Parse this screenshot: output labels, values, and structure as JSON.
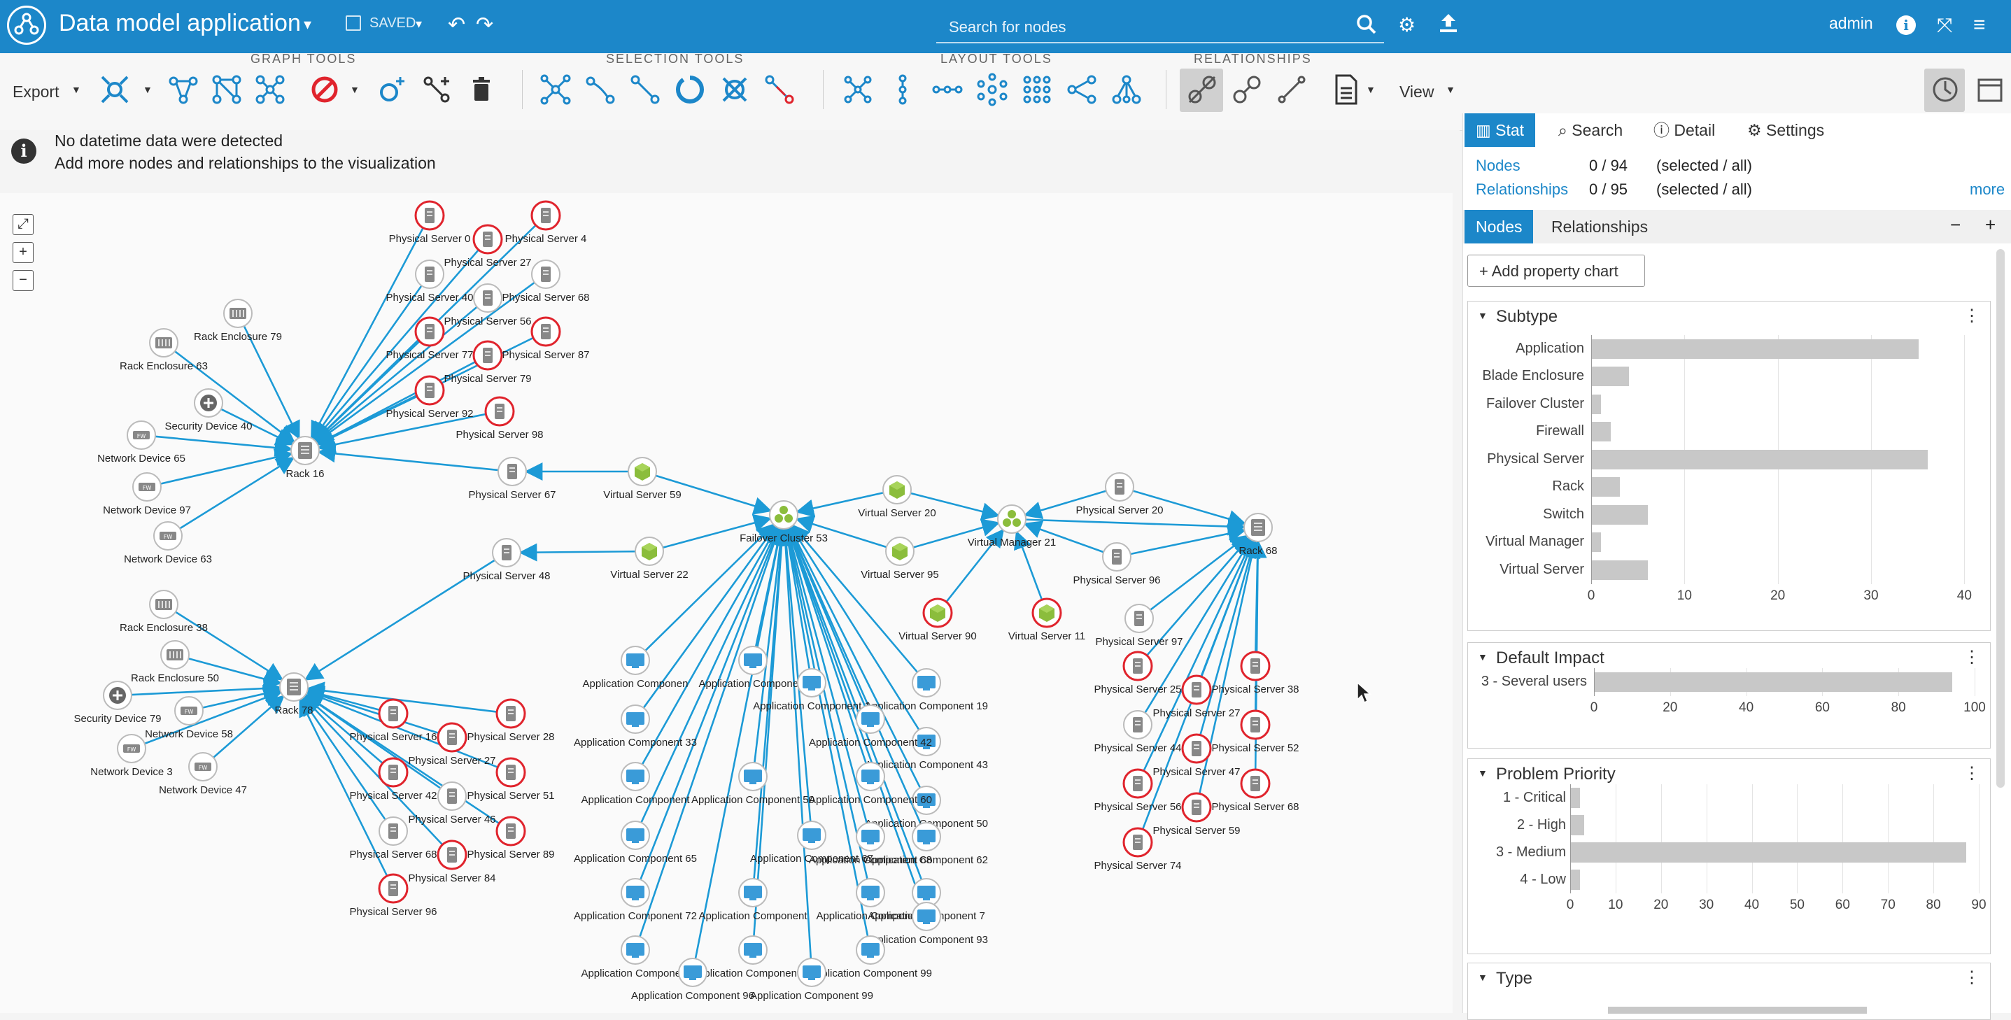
{
  "header": {
    "title": "Data model application",
    "saved": "SAVED",
    "search_placeholder": "Search for nodes",
    "user": "admin"
  },
  "toolbar": {
    "export_label": "Export",
    "view_label": "View",
    "groups": [
      "GRAPH TOOLS",
      "SELECTION TOOLS",
      "LAYOUT TOOLS",
      "RELATIONSHIPS"
    ]
  },
  "info": {
    "line1": "No datetime data were detected",
    "line2": "Add more nodes and relationships to the visualization"
  },
  "panel": {
    "tabs": [
      "Stat",
      "Search",
      "Detail",
      "Settings"
    ],
    "nodes_label": "Nodes",
    "nodes_count": "0 / 94",
    "nodes_hint": "(selected / all)",
    "rels_label": "Relationships",
    "rels_count": "0 / 95",
    "rels_hint": "(selected / all)",
    "more": "more",
    "subtabs": [
      "Nodes",
      "Relationships"
    ],
    "add_chart": "Add property chart"
  },
  "charts": [
    {
      "title": "Subtype",
      "categories": [
        "Application",
        "Blade Enclosure",
        "Failover Cluster",
        "Firewall",
        "Physical Server",
        "Rack",
        "Switch",
        "Virtual Manager",
        "Virtual Server"
      ],
      "values": [
        35,
        4,
        1,
        2,
        36,
        3,
        6,
        1,
        6
      ],
      "max": 42,
      "ticks": [
        0,
        10,
        20,
        30,
        40
      ]
    },
    {
      "title": "Default Impact",
      "categories": [
        "3 - Several users"
      ],
      "values": [
        94
      ],
      "max": 100,
      "ticks": [
        0,
        20,
        40,
        60,
        80,
        100
      ]
    },
    {
      "title": "Problem Priority",
      "categories": [
        "1 - Critical",
        "2 - High",
        "3 - Medium",
        "4 - Low"
      ],
      "values": [
        2,
        3,
        87,
        2
      ],
      "max": 90,
      "ticks": [
        0,
        10,
        20,
        30,
        40,
        50,
        60,
        70,
        80,
        90
      ]
    },
    {
      "title": "Type"
    }
  ],
  "graph": {
    "nodes": [
      {
        "id": "ps0",
        "label": "Physical Server 0",
        "type": "server",
        "alert": true
      },
      {
        "id": "ps4",
        "label": "Physical Server 4",
        "type": "server",
        "alert": true
      },
      {
        "id": "ps27a",
        "label": "Physical Server 27",
        "type": "server",
        "alert": true
      },
      {
        "id": "ps40",
        "label": "Physical Server 40",
        "type": "server",
        "alert": false
      },
      {
        "id": "ps68a",
        "label": "Physical Server 68",
        "type": "server",
        "alert": false
      },
      {
        "id": "ps56a",
        "label": "Physical Server 56",
        "type": "server",
        "alert": false
      },
      {
        "id": "ps77",
        "label": "Physical Server 77",
        "type": "server",
        "alert": true
      },
      {
        "id": "ps87",
        "label": "Physical Server 87",
        "type": "server",
        "alert": true
      },
      {
        "id": "ps79",
        "label": "Physical Server 79",
        "type": "server",
        "alert": true
      },
      {
        "id": "ps92",
        "label": "Physical Server 92",
        "type": "server",
        "alert": true
      },
      {
        "id": "ps98",
        "label": "Physical Server 98",
        "type": "server",
        "alert": true
      },
      {
        "id": "re79",
        "label": "Rack Enclosure 79",
        "type": "enclosure",
        "alert": false
      },
      {
        "id": "re63",
        "label": "Rack Enclosure 63",
        "type": "enclosure",
        "alert": false
      },
      {
        "id": "sd40",
        "label": "Security Device 40",
        "type": "security",
        "alert": false
      },
      {
        "id": "nd65",
        "label": "Network Device 65",
        "type": "network",
        "alert": false
      },
      {
        "id": "nd97",
        "label": "Network Device 97",
        "type": "network",
        "alert": false
      },
      {
        "id": "nd63",
        "label": "Network Device 63",
        "type": "network",
        "alert": false
      },
      {
        "id": "rack16",
        "label": "Rack 16",
        "type": "rack",
        "alert": false
      },
      {
        "id": "ps67",
        "label": "Physical Server 67",
        "type": "server",
        "alert": false
      },
      {
        "id": "vs59",
        "label": "Virtual Server 59",
        "type": "virtual",
        "alert": false
      },
      {
        "id": "fc53",
        "label": "Failover Cluster 53",
        "type": "cluster",
        "alert": false
      },
      {
        "id": "vs20",
        "label": "Virtual Server 20",
        "type": "virtual",
        "alert": false
      },
      {
        "id": "vs95",
        "label": "Virtual Server 95",
        "type": "virtual",
        "alert": false
      },
      {
        "id": "vm21",
        "label": "Virtual Manager 21",
        "type": "cluster",
        "alert": false
      },
      {
        "id": "vs90",
        "label": "Virtual Server 90",
        "type": "virtual",
        "alert": true
      },
      {
        "id": "vs11",
        "label": "Virtual Server 11",
        "type": "virtual",
        "alert": true
      },
      {
        "id": "ps20",
        "label": "Physical Server 20",
        "type": "server",
        "alert": false
      },
      {
        "id": "ps96a",
        "label": "Physical Server 96",
        "type": "server",
        "alert": false
      },
      {
        "id": "rack68",
        "label": "Rack 68",
        "type": "rack",
        "alert": false
      },
      {
        "id": "vs22",
        "label": "Virtual Server 22",
        "type": "virtual",
        "alert": false
      },
      {
        "id": "ps48",
        "label": "Physical Server 48",
        "type": "server",
        "alert": false
      },
      {
        "id": "re38",
        "label": "Rack Enclosure 38",
        "type": "enclosure",
        "alert": false
      },
      {
        "id": "re50",
        "label": "Rack Enclosure 50",
        "type": "enclosure",
        "alert": false
      },
      {
        "id": "sd79",
        "label": "Security Device 79",
        "type": "security",
        "alert": false
      },
      {
        "id": "nd58",
        "label": "Network Device 58",
        "type": "network",
        "alert": false
      },
      {
        "id": "nd3",
        "label": "Network Device 3",
        "type": "network",
        "alert": false
      },
      {
        "id": "nd47",
        "label": "Network Device 47",
        "type": "network",
        "alert": false
      },
      {
        "id": "rack78",
        "label": "Rack 78",
        "type": "rack",
        "alert": false
      },
      {
        "id": "ps16",
        "label": "Physical Server 16",
        "type": "server",
        "alert": true
      },
      {
        "id": "ps28",
        "label": "Physical Server 28",
        "type": "server",
        "alert": true
      },
      {
        "id": "ps27b",
        "label": "Physical Server 27",
        "type": "server",
        "alert": true
      },
      {
        "id": "ps42",
        "label": "Physical Server 42",
        "type": "server",
        "alert": true
      },
      {
        "id": "ps51",
        "label": "Physical Server 51",
        "type": "server",
        "alert": true
      },
      {
        "id": "ps46",
        "label": "Physical Server 46",
        "type": "server",
        "alert": false
      },
      {
        "id": "ps68b",
        "label": "Physical Server 68",
        "type": "server",
        "alert": false
      },
      {
        "id": "ps89",
        "label": "Physical Server 89",
        "type": "server",
        "alert": true
      },
      {
        "id": "ps84",
        "label": "Physical Server 84",
        "type": "server",
        "alert": true
      },
      {
        "id": "ps96b",
        "label": "Physical Server 96",
        "type": "server",
        "alert": true
      },
      {
        "id": "ps97",
        "label": "Physical Server 97",
        "type": "server",
        "alert": false
      },
      {
        "id": "ps25",
        "label": "Physical Server 25",
        "type": "server",
        "alert": true
      },
      {
        "id": "ps38",
        "label": "Physical Server 38",
        "type": "server",
        "alert": true
      },
      {
        "id": "ps27c",
        "label": "Physical Server 27",
        "type": "server",
        "alert": true
      },
      {
        "id": "ps44",
        "label": "Physical Server 44",
        "type": "server",
        "alert": false
      },
      {
        "id": "ps52",
        "label": "Physical Server 52",
        "type": "server",
        "alert": true
      },
      {
        "id": "ps47",
        "label": "Physical Server 47",
        "type": "server",
        "alert": true
      },
      {
        "id": "ps56b",
        "label": "Physical Server 56",
        "type": "server",
        "alert": true
      },
      {
        "id": "ps68c",
        "label": "Physical Server 68",
        "type": "server",
        "alert": true
      },
      {
        "id": "ps59",
        "label": "Physical Server 59",
        "type": "server",
        "alert": true
      },
      {
        "id": "ps74",
        "label": "Physical Server 74",
        "type": "server",
        "alert": true
      },
      {
        "id": "ac_a",
        "label": "Application Componen",
        "type": "app",
        "alert": false
      },
      {
        "id": "ac_b",
        "label": "Application Component",
        "type": "app",
        "alert": false
      },
      {
        "id": "ac_c",
        "label": "Application Component 19",
        "type": "app",
        "alert": false
      },
      {
        "id": "ac_d",
        "label": "Application Component 1",
        "type": "app",
        "alert": false
      },
      {
        "id": "ac_e",
        "label": "Application Component 33",
        "type": "app",
        "alert": false
      },
      {
        "id": "ac_f",
        "label": "Application Component 43",
        "type": "app",
        "alert": false
      },
      {
        "id": "ac_g",
        "label": "Application Component 50",
        "type": "app",
        "alert": false
      },
      {
        "id": "ac_h",
        "label": "Application Component 42",
        "type": "app",
        "alert": false
      },
      {
        "id": "ac_i",
        "label": "Application Component",
        "type": "app",
        "alert": false
      },
      {
        "id": "ac_j",
        "label": "Application Component 60",
        "type": "app",
        "alert": false
      },
      {
        "id": "ac_k",
        "label": "Application Component 62",
        "type": "app",
        "alert": false
      },
      {
        "id": "ac_l",
        "label": "Application Component 50",
        "type": "app",
        "alert": false
      },
      {
        "id": "ac_m",
        "label": "Application Component 68",
        "type": "app",
        "alert": false
      },
      {
        "id": "ac_n",
        "label": "Application Component 65",
        "type": "app",
        "alert": false
      },
      {
        "id": "ac_o",
        "label": "Application Component 67",
        "type": "app",
        "alert": false
      },
      {
        "id": "ac_p",
        "label": "Application Component 7",
        "type": "app",
        "alert": false
      },
      {
        "id": "ac_q",
        "label": "Application Component 72",
        "type": "app",
        "alert": false
      },
      {
        "id": "ac_r",
        "label": "Application Component",
        "type": "app",
        "alert": false
      },
      {
        "id": "ac_s",
        "label": "Application Component",
        "type": "app",
        "alert": false
      },
      {
        "id": "ac_t",
        "label": "Application Component 93",
        "type": "app",
        "alert": false
      },
      {
        "id": "ac_u",
        "label": "Application Component",
        "type": "app",
        "alert": false
      },
      {
        "id": "ac_v",
        "label": "Application Component 97",
        "type": "app",
        "alert": false
      },
      {
        "id": "ac_w",
        "label": "Application Component 99",
        "type": "app",
        "alert": false
      },
      {
        "id": "ac_x",
        "label": "Application Component 96",
        "type": "app",
        "alert": false
      },
      {
        "id": "ac_y",
        "label": "Application Component 99",
        "type": "app",
        "alert": false
      }
    ]
  }
}
